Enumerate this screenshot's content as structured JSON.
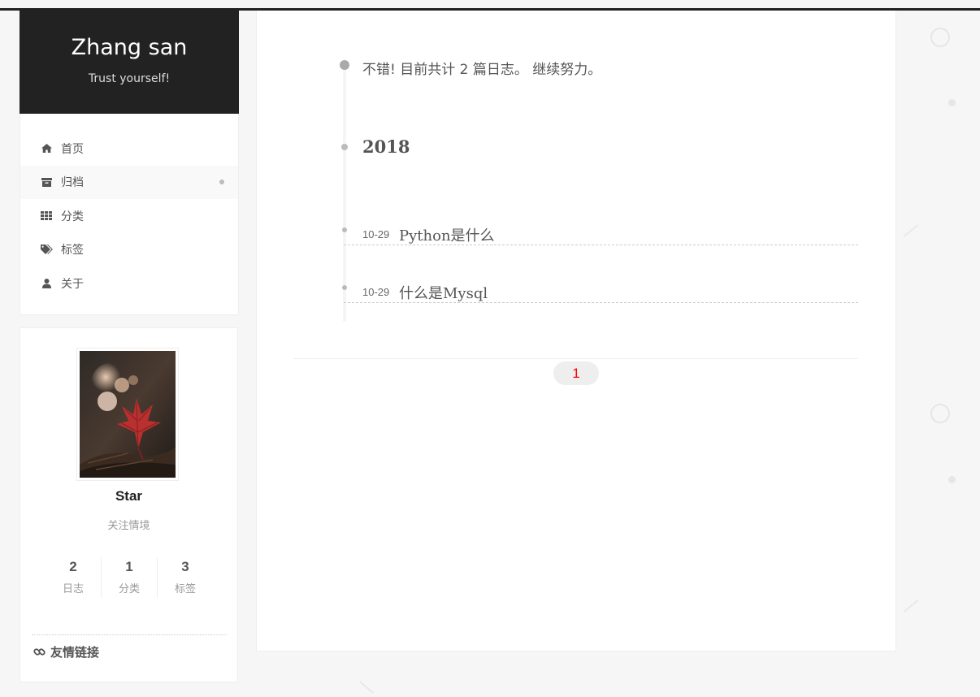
{
  "site": {
    "title": "Zhang san",
    "subtitle": "Trust yourself!"
  },
  "menu": {
    "items": [
      {
        "label": "首页",
        "icon": "home-icon"
      },
      {
        "label": "归档",
        "icon": "archive-icon",
        "active": true
      },
      {
        "label": "分类",
        "icon": "grid-icon"
      },
      {
        "label": "标签",
        "icon": "tags-icon"
      },
      {
        "label": "关于",
        "icon": "user-icon"
      }
    ]
  },
  "author": {
    "name": "Star",
    "description": "关注情境",
    "stats": [
      {
        "count": "2",
        "label": "日志"
      },
      {
        "count": "1",
        "label": "分类"
      },
      {
        "count": "3",
        "label": "标签"
      }
    ],
    "links_title": "友情链接"
  },
  "archive": {
    "intro": "不错! 目前共计 2 篇日志。 继续努力。",
    "year": "2018",
    "posts": [
      {
        "date": "10-29",
        "title": "Python是什么"
      },
      {
        "date": "10-29",
        "title": "什么是Mysql"
      }
    ]
  },
  "pagination": {
    "current": "1"
  },
  "colors": {
    "header_bg": "#222222",
    "active_page": "#ff0000",
    "page_bg": "#f6f6f6"
  }
}
